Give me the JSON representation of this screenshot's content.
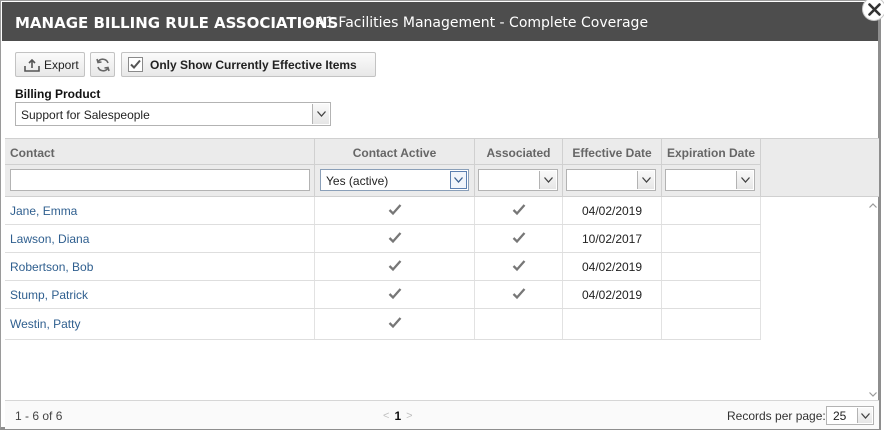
{
  "dialog": {
    "title": "MANAGE BILLING RULE ASSOCIATIONS",
    "subtitle": "- A1 Facilities Management - Complete Coverage"
  },
  "toolbar": {
    "export_label": "Export",
    "only_effective_label": "Only Show Currently Effective Items",
    "only_effective_checked": true
  },
  "billing_product": {
    "label": "Billing Product",
    "selected": "Support for Salespeople"
  },
  "grid": {
    "columns": [
      "Contact",
      "Contact Active",
      "Associated",
      "Effective Date",
      "Expiration Date"
    ],
    "filters": {
      "contact": "",
      "contact_active": "Yes (active)",
      "associated": "",
      "effective_date": "",
      "expiration_date": ""
    },
    "rows": [
      {
        "contact": "Jane, Emma",
        "active": true,
        "associated": true,
        "effective": "04/02/2019",
        "expiration": ""
      },
      {
        "contact": "Lawson, Diana",
        "active": true,
        "associated": true,
        "effective": "10/02/2017",
        "expiration": ""
      },
      {
        "contact": "Robertson, Bob",
        "active": true,
        "associated": true,
        "effective": "04/02/2019",
        "expiration": ""
      },
      {
        "contact": "Stump, Patrick",
        "active": true,
        "associated": true,
        "effective": "04/02/2019",
        "expiration": ""
      },
      {
        "contact": "Westin, Patty",
        "active": true,
        "associated": false,
        "effective": "",
        "expiration": ""
      }
    ]
  },
  "footer": {
    "count": "1 - 6 of 6",
    "prev": "<",
    "page": "1",
    "next": ">",
    "records_label": "Records per page:",
    "records_value": "25"
  },
  "icons": {
    "close": "close-icon",
    "export": "export-icon",
    "refresh": "refresh-icon",
    "checkbox": "checkbox-checked-icon",
    "dropdown": "chevron-down-icon",
    "check": "checkmark-icon"
  },
  "colors": {
    "titlebar": "#4d4d4d",
    "link": "#2f5f8f",
    "header_bg": "#ebebeb",
    "check": "#777777"
  }
}
